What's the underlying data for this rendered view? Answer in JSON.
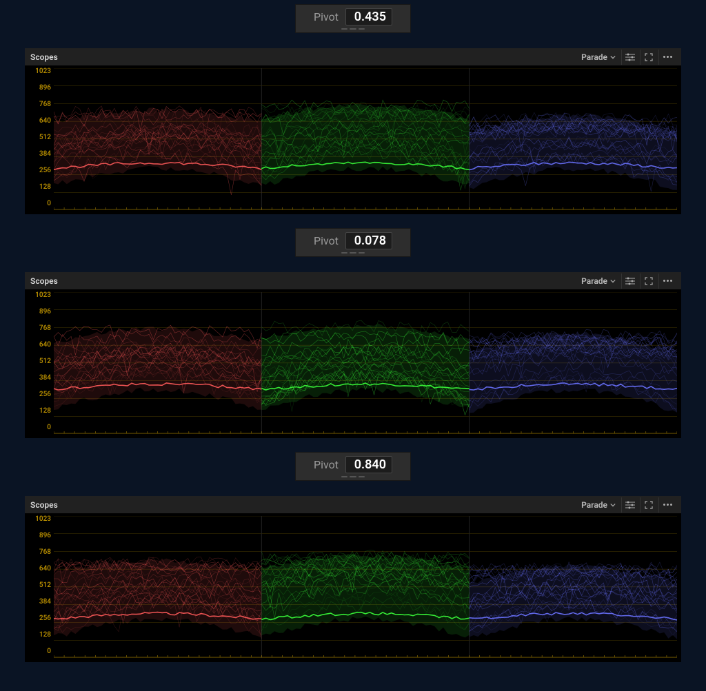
{
  "pivots": [
    {
      "label": "Pivot",
      "value": "0.435"
    },
    {
      "label": "Pivot",
      "value": "0.078"
    },
    {
      "label": "Pivot",
      "value": "0.840"
    }
  ],
  "scopes": {
    "title": "Scopes",
    "mode": "Parade",
    "y_ticks": [
      "1023",
      "896",
      "768",
      "640",
      "512",
      "384",
      "256",
      "128",
      "0"
    ],
    "channels": [
      {
        "name": "red",
        "color": "#ff5a5a"
      },
      {
        "name": "green",
        "color": "#3bff3b"
      },
      {
        "name": "blue",
        "color": "#6a72ff"
      }
    ]
  },
  "chart_data": [
    {
      "type": "parade",
      "title": "Scopes – Parade (Pivot 0.435)",
      "ylim": [
        0,
        1023
      ],
      "channels": {
        "red": {
          "band_top_max": 720,
          "band_top_min": 640,
          "band_bot_max": 300,
          "band_bot_min": 180,
          "centroid": 400
        },
        "green": {
          "band_top_max": 760,
          "band_top_min": 660,
          "band_bot_max": 300,
          "band_bot_min": 180,
          "centroid": 420
        },
        "blue": {
          "band_top_max": 680,
          "band_top_min": 560,
          "band_bot_max": 300,
          "band_bot_min": 150,
          "centroid": 370
        }
      }
    },
    {
      "type": "parade",
      "title": "Scopes – Parade (Pivot 0.078)",
      "ylim": [
        0,
        1023
      ],
      "channels": {
        "red": {
          "band_top_max": 760,
          "band_top_min": 660,
          "band_bot_max": 320,
          "band_bot_min": 180,
          "centroid": 420
        },
        "green": {
          "band_top_max": 780,
          "band_top_min": 680,
          "band_bot_max": 320,
          "band_bot_min": 180,
          "centroid": 430
        },
        "blue": {
          "band_top_max": 720,
          "band_top_min": 580,
          "band_bot_max": 320,
          "band_bot_min": 160,
          "centroid": 390
        }
      }
    },
    {
      "type": "parade",
      "title": "Scopes – Parade (Pivot 0.840)",
      "ylim": [
        0,
        1023
      ],
      "channels": {
        "red": {
          "band_top_max": 700,
          "band_top_min": 620,
          "band_bot_max": 280,
          "band_bot_min": 150,
          "centroid": 380
        },
        "green": {
          "band_top_max": 740,
          "band_top_min": 640,
          "band_bot_max": 280,
          "band_bot_min": 150,
          "centroid": 400
        },
        "blue": {
          "band_top_max": 660,
          "band_top_min": 540,
          "band_bot_max": 280,
          "band_bot_min": 140,
          "centroid": 350
        }
      }
    }
  ]
}
